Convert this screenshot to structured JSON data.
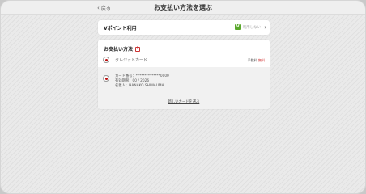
{
  "header": {
    "back_label": "戻る",
    "title": "お支払い方法を選ぶ"
  },
  "points": {
    "label": "Vポイント利用",
    "icon_text": "V",
    "value": "利用しない"
  },
  "payment": {
    "title": "お支払い方法",
    "help": "?",
    "credit_card_label": "クレジットカード",
    "fee_prefix": "手数料",
    "fee_value": "無料",
    "card_number": "カード番号：**************0000",
    "expiry": "有効期限：00 / 2026",
    "holder": "名義人：HANAKO SHIMAUMA",
    "new_card_link": "新しいカードを選ぶ"
  },
  "colors": {
    "accent": "#b11111",
    "points_green": "#5aa82c"
  }
}
